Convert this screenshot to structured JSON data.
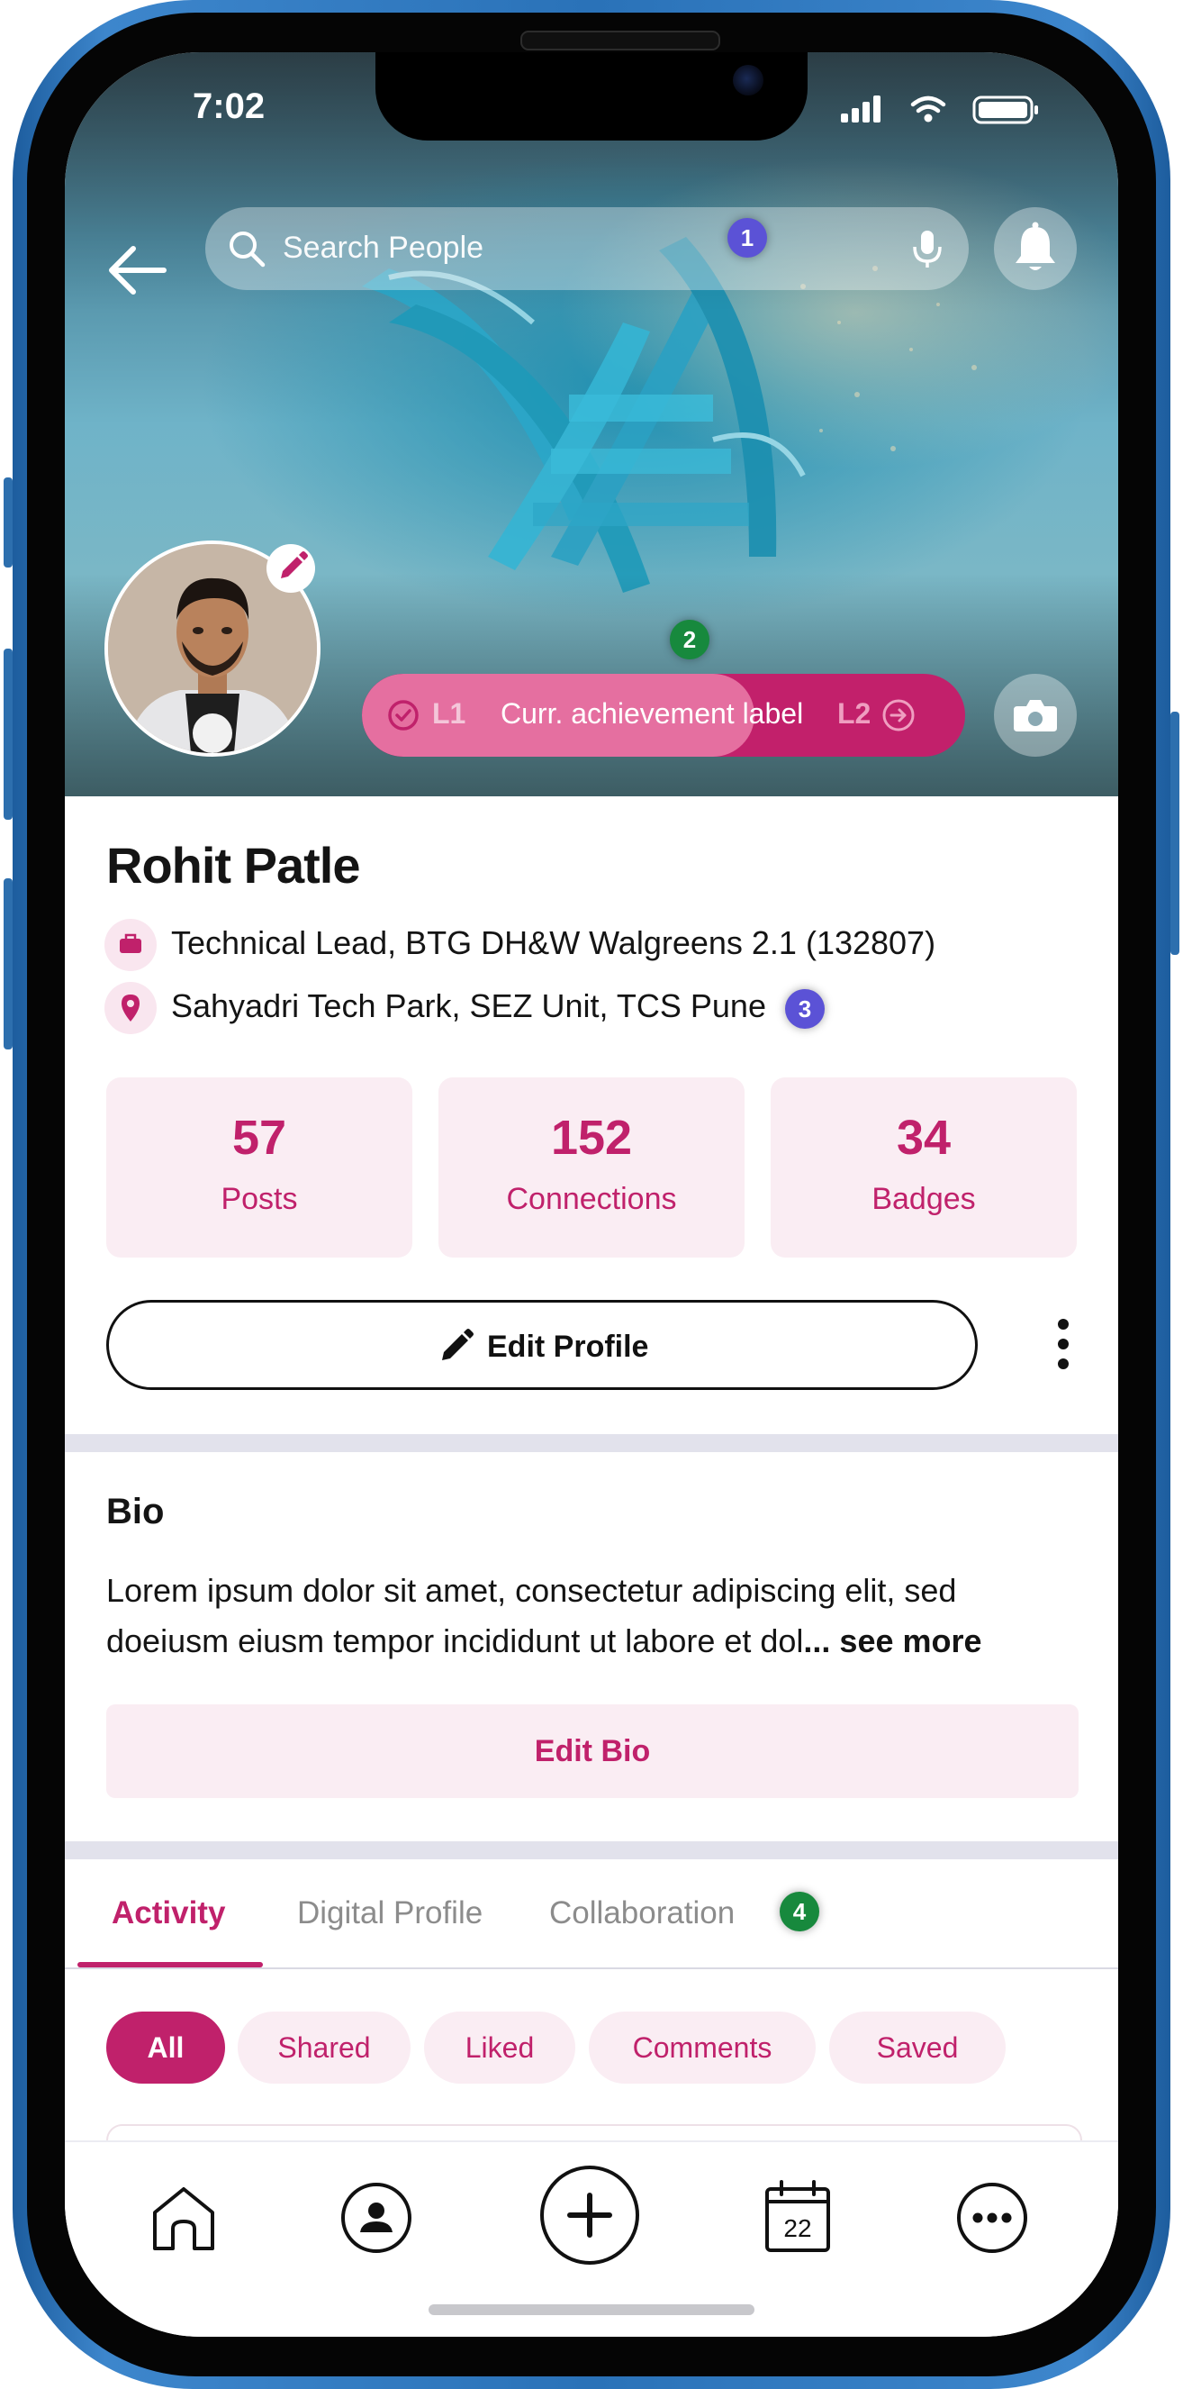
{
  "status_bar": {
    "time": "7:02"
  },
  "header": {
    "search_placeholder": "Search People",
    "markers": {
      "search": "1",
      "achievement": "2",
      "location": "3",
      "tabs": "4"
    }
  },
  "achievement": {
    "current_level": "L1",
    "label": "Curr. achievement label",
    "next_level": "L2",
    "progress": 0.65
  },
  "profile": {
    "name": "Rohit Patle",
    "title": "Technical Lead, BTG DH&W Walgreens 2.1 (132807)",
    "location": "Sahyadri Tech Park, SEZ Unit, TCS Pune"
  },
  "stats": [
    {
      "value": "57",
      "label": "Posts"
    },
    {
      "value": "152",
      "label": "Connections"
    },
    {
      "value": "34",
      "label": "Badges"
    }
  ],
  "actions": {
    "edit_profile": "Edit Profile"
  },
  "bio": {
    "title": "Bio",
    "text": "Lorem ipsum dolor sit amet, consectetur adipiscing elit, sed doeiusm eiusm tempor incididunt ut labore et dol",
    "see_more": "... see more",
    "edit_bio": "Edit Bio"
  },
  "tabs": [
    {
      "label": "Activity",
      "active": true
    },
    {
      "label": "Digital Profile",
      "active": false
    },
    {
      "label": "Collaboration",
      "active": false
    }
  ],
  "filters": [
    {
      "label": "All",
      "active": true
    },
    {
      "label": "Shared",
      "active": false
    },
    {
      "label": "Liked",
      "active": false
    },
    {
      "label": "Comments",
      "active": false
    },
    {
      "label": "Saved",
      "active": false
    }
  ],
  "bottom_nav": {
    "calendar_day": "22"
  },
  "icons": [
    "back-arrow-icon",
    "search-icon",
    "mic-icon",
    "bell-icon",
    "pencil-icon",
    "check-circle-icon",
    "arrow-right-circle-icon",
    "camera-icon",
    "briefcase-icon",
    "location-pin-icon",
    "more-vertical-icon",
    "home-icon",
    "profile-icon",
    "plus-icon",
    "calendar-icon",
    "more-horizontal-icon"
  ],
  "colors": {
    "accent": "#c0216b",
    "accent_light": "#faedf3",
    "marker_purple": "#5b52d6",
    "marker_green": "#17893d"
  }
}
